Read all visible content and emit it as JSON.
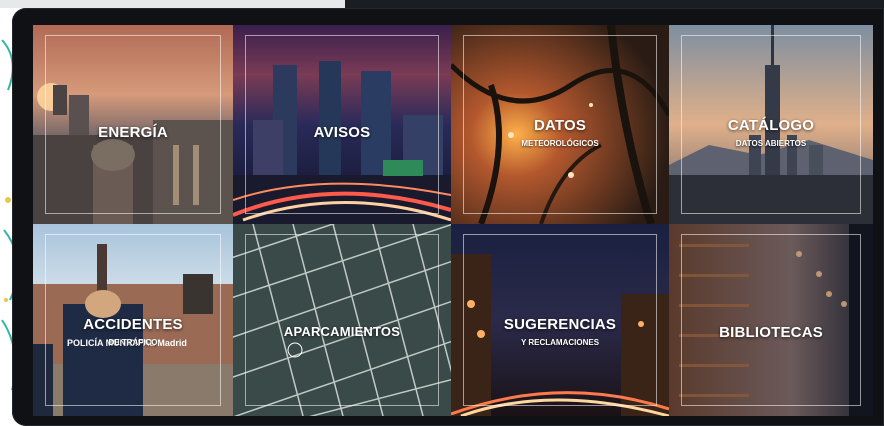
{
  "tiles": [
    {
      "id": "energia",
      "title": "ENERGÍA",
      "subtitle": ""
    },
    {
      "id": "avisos",
      "title": "AVISOS",
      "subtitle": ""
    },
    {
      "id": "datos",
      "title": "DATOS",
      "subtitle": "METEOROLÓGICOS"
    },
    {
      "id": "catalogo",
      "title": "CATÁLOGO",
      "subtitle": "DATOS ABIERTOS"
    },
    {
      "id": "accidentes",
      "title": "ACCIDENTES",
      "subtitle": "DE TRÁFICO"
    },
    {
      "id": "aparcamientos",
      "title": "APARCAMIENTOS",
      "subtitle": ""
    },
    {
      "id": "sugerencias",
      "title": "SUGERENCIAS",
      "subtitle": "Y RECLAMACIONES"
    },
    {
      "id": "bibliotecas",
      "title": "BIBLIOTECAS",
      "subtitle": ""
    }
  ],
  "badge_text": "POLICÍA MUNICIPAL Madrid"
}
